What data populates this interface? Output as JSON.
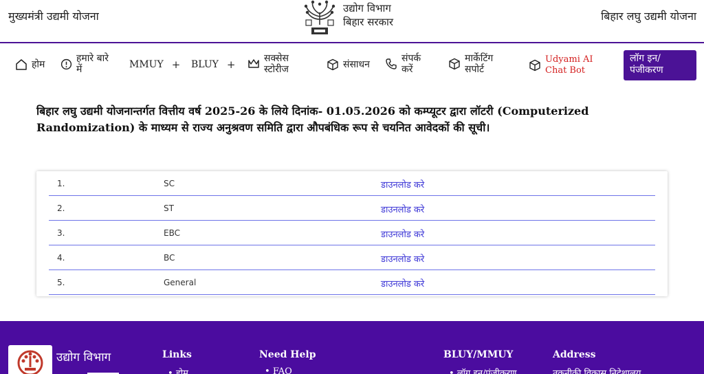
{
  "header": {
    "left_title": "मुख्यमंत्री उद्यमी योजना",
    "dept_line1": "उद्योग विभाग",
    "dept_line2": "बिहार सरकार",
    "right_title": "बिहार लघु उद्यमी योजना"
  },
  "nav": {
    "home": "होम",
    "about": "हमारे बारे में",
    "mmuy": "MMUY",
    "bluy": "BLUY",
    "success": "सक्सेस स्टोरीज",
    "resources": "संसाधन",
    "contact": "संपर्क करें",
    "marketing": "मार्केटिंग सपोर्ट",
    "chatbot": "Udyami AI Chat Bot",
    "login": "लॉग इन/ पंजीकरण",
    "plus": "+"
  },
  "notice": {
    "text": "बिहार लघु उद्यमी योजनान्तर्गत वित्तीय वर्ष 2025-26 के लिये दिनांक- 01.05.2026 को कम्प्यूटर द्वारा लॉटरी (Computerized Randomization) के माध्यम से राज्य अनुश्रवण समिति द्वारा औपबंधिक रूप से चयनित आवेदकों की सूची।"
  },
  "table": {
    "rows": [
      {
        "num": "1.",
        "category": "SC",
        "link": "डाउनलोड करे"
      },
      {
        "num": "2.",
        "category": "ST",
        "link": "डाउनलोड करे"
      },
      {
        "num": "3.",
        "category": "EBC",
        "link": "डाउनलोड करे"
      },
      {
        "num": "4.",
        "category": "BC",
        "link": "डाउनलोड करे"
      },
      {
        "num": "5.",
        "category": "General",
        "link": "डाउनलोड करे"
      }
    ]
  },
  "footer": {
    "dept": "उद्योग विभाग",
    "links_title": "Links",
    "links_item": "होम",
    "help_title": "Need Help",
    "help_item": "FAQ",
    "bluy_title": "BLUY/MMUY",
    "bluy_item": "लॉग इन/पंजीकरण",
    "address_title": "Address",
    "address_item": "तकनीकी विकास निदेशालय"
  },
  "colors": {
    "brand_purple": "#4b1296",
    "footer_purple": "#4b0c9f",
    "link_blue": "#3b35d6",
    "chatbot_red": "#d41f1f"
  }
}
